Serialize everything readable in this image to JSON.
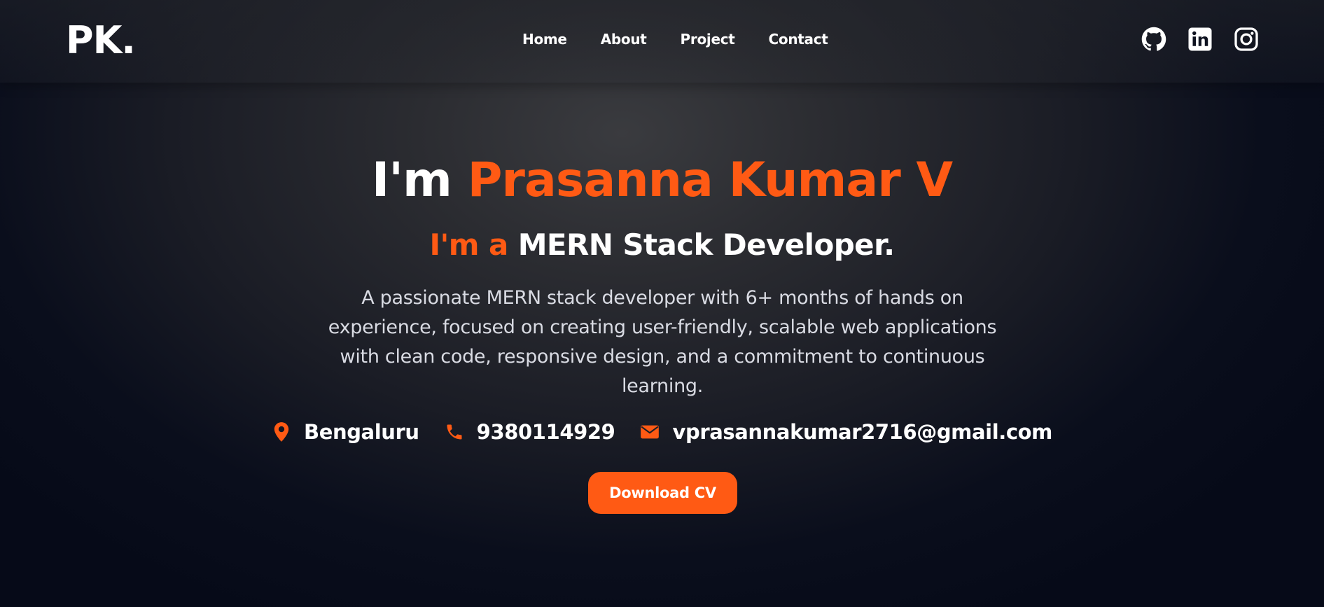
{
  "nav": {
    "logo": "PK.",
    "links": [
      "Home",
      "About",
      "Project",
      "Contact"
    ],
    "socials": [
      "github-icon",
      "linkedin-icon",
      "instagram-icon"
    ]
  },
  "hero": {
    "title_prefix": "I'm ",
    "title_name": "Prasanna Kumar V",
    "subtitle_prefix": "I'm a ",
    "subtitle_role": "MERN Stack Developer.",
    "description": "A passionate MERN stack developer with 6+ months of hands on experience, focused on creating user-friendly, scalable web applications with clean code, responsive design, and a commitment to continuous learning.",
    "location": "Bengaluru",
    "phone": "9380114929",
    "email": "vprasannakumar2716@gmail.com",
    "cta": "Download CV"
  },
  "colors": {
    "accent": "#ff5a14",
    "background": "#0a0e1c",
    "text": "#ffffff"
  }
}
